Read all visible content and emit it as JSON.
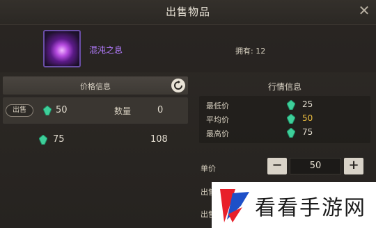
{
  "window": {
    "title": "出售物品",
    "close_icon": "close-icon"
  },
  "item": {
    "name": "混沌之息",
    "owned": "拥有: 12",
    "name_color": "#b37cff"
  },
  "price_panel": {
    "title": "价格信息",
    "rows": [
      {
        "sell_label": "出售",
        "price": "50",
        "qty_label": "数量",
        "qty": "0"
      },
      {
        "price": "75",
        "qty": "108"
      }
    ]
  },
  "market_panel": {
    "title": "行情信息",
    "rows": [
      {
        "label": "最低价",
        "value": "25"
      },
      {
        "label": "平均价",
        "value": "50"
      },
      {
        "label": "最高价",
        "value": "75"
      }
    ],
    "avg_color": "#f0c040"
  },
  "sell_form": {
    "unit_label": "单价",
    "unit_value": "50",
    "minus": "−",
    "plus": "+",
    "qty_label": "出售",
    "price_label": "出售"
  },
  "watermark": {
    "text": "看看手游网"
  },
  "colors": {
    "gem": "#3ecf9a",
    "accent": "#f0c040",
    "background": "#2b2724"
  }
}
